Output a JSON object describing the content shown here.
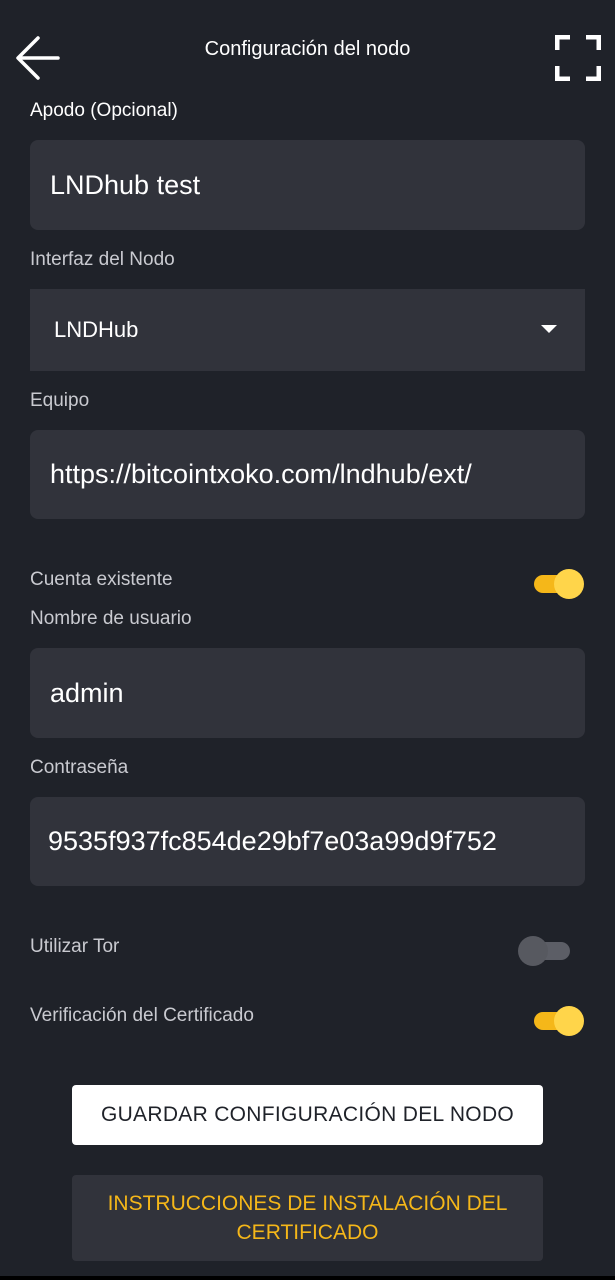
{
  "header": {
    "title": "Configuración del nodo",
    "back_icon": "arrow-left-icon",
    "fullscreen_icon": "fullscreen-icon"
  },
  "form": {
    "nickname_label": "Apodo (Opcional)",
    "nickname_value": "LNDhub test",
    "interface_label": "Interfaz del Nodo",
    "interface_value": "LNDHub",
    "host_label": "Equipo",
    "host_value": "https://bitcointxoko.com/lndhub/ext/",
    "existing_account_label": "Cuenta existente",
    "existing_account_on": true,
    "username_label": "Nombre de usuario",
    "username_value": "admin",
    "password_label": "Contraseña",
    "password_value": "9535f937fc854de29bf7e03a99d9f752",
    "tor_label": "Utilizar Tor",
    "tor_on": false,
    "cert_label": "Verificación del Certificado",
    "cert_on": true
  },
  "actions": {
    "save_label": "GUARDAR CONFIGURACIÓN DEL NODO",
    "instructions_label": "INSTRUCCIONES DE INSTALACIÓN DEL CERTIFICADO"
  },
  "colors": {
    "background": "#1f2229",
    "field": "#31333b",
    "accent": "#f5b719"
  }
}
